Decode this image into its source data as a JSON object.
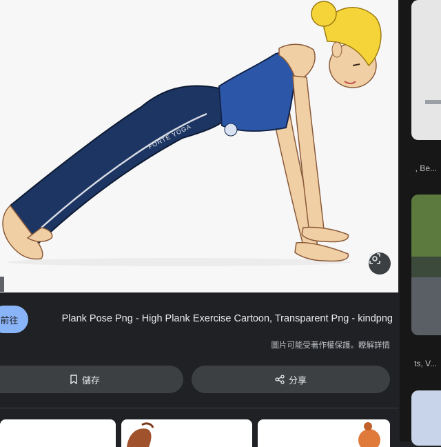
{
  "preview": {
    "title": "Plank Pose Png - High Plank Exercise Cartoon, Transparent Png - kindpng",
    "notice": "圖片可能受著作權保護。瞭解詳情",
    "visit_label": "前往",
    "share_label": "分享",
    "save_label": "儲存",
    "shirt_logo": "FORTE YOGA"
  },
  "side_results": {
    "captions": [
      ", Be...",
      "ts, V..."
    ]
  },
  "colors": {
    "background": "#202124",
    "accent": "#8ab4f8",
    "pill": "#3c4043"
  }
}
